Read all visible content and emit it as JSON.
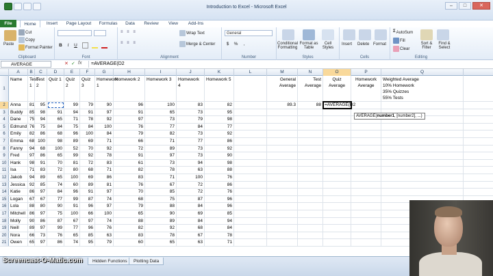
{
  "window": {
    "title": "Introduction to Excel - Microsoft Excel",
    "buttons": {
      "minimize": "–",
      "maximize": "□",
      "close": "✕"
    }
  },
  "tabs": [
    "File",
    "Home",
    "Insert",
    "Page Layout",
    "Formulas",
    "Data",
    "Review",
    "View",
    "Add-Ins"
  ],
  "ribbon": {
    "clipboard": {
      "paste": "Paste",
      "cut": "Cut",
      "copy": "Copy",
      "format_painter": "Format Painter",
      "label": "Clipboard"
    },
    "font": {
      "bold": "B",
      "italic": "I",
      "underline": "U",
      "label": "Font"
    },
    "alignment": {
      "wrap_text": "Wrap Text",
      "merge_center": "Merge & Center",
      "label": "Alignment"
    },
    "number": {
      "format": "General",
      "currency": "$",
      "percent": "%",
      "comma": ",",
      "label": "Number"
    },
    "styles": {
      "conditional": "Conditional Formatting",
      "format_table": "Format as Table",
      "cell_styles": "Cell Styles",
      "label": "Styles"
    },
    "cells": {
      "insert": "Insert",
      "delete": "Delete",
      "format": "Format",
      "label": "Cells"
    },
    "editing": {
      "autosum": "AutoSum",
      "fill": "Fill",
      "clear": "Clear",
      "sort_filter": "Sort & Filter",
      "find_select": "Find & Select",
      "label": "Editing"
    }
  },
  "formula_bar": {
    "name_box": "AVERAGE",
    "cancel": "✕",
    "enter": "✓",
    "fx": "fx",
    "formula": "=AVERAGE(D2"
  },
  "columns": [
    "A",
    "B",
    "C",
    "D",
    "E",
    "F",
    "G",
    "H",
    "I",
    "J",
    "K",
    "L",
    "M",
    "N",
    "O",
    "P",
    "Q"
  ],
  "header_row": {
    "A": "Name",
    "B": "Test 1",
    "C": "Test 2",
    "D": "Quiz 1",
    "E": "Quiz 2",
    "F": "Quiz 3",
    "G": "Homework 1",
    "H": "Homework 2",
    "I": "Homework 3",
    "J": "Homework 4",
    "K": "Homework 5",
    "M": "General Average",
    "N": "Test Average",
    "O": "Quiz Average",
    "P": "Homework Average",
    "Q": [
      "Weighted Average",
      "10% Homework",
      "35% Quizzes",
      "55% Tests"
    ]
  },
  "rows": [
    [
      "Anna",
      81,
      95,
      "",
      99,
      79,
      90,
      96,
      100,
      83,
      82
    ],
    [
      "Buddy",
      85,
      98,
      91,
      94,
      91,
      97,
      91,
      65,
      73,
      95
    ],
    [
      "Dane",
      75,
      94,
      65,
      71,
      78,
      92,
      97,
      73,
      79,
      98
    ],
    [
      "Edmund",
      76,
      75,
      84,
      75,
      84,
      100,
      76,
      77,
      84,
      77
    ],
    [
      "Emily",
      82,
      86,
      68,
      96,
      100,
      84,
      79,
      82,
      73,
      92
    ],
    [
      "Emma",
      68,
      100,
      98,
      89,
      69,
      71,
      66,
      71,
      77,
      86
    ],
    [
      "Fanny",
      94,
      68,
      100,
      52,
      70,
      92,
      72,
      89,
      73,
      92
    ],
    [
      "Fred",
      97,
      86,
      65,
      99,
      92,
      78,
      91,
      97,
      73,
      90
    ],
    [
      "Hank",
      98,
      91,
      70,
      81,
      72,
      83,
      61,
      73,
      94,
      98
    ],
    [
      "Isa",
      71,
      83,
      72,
      80,
      68,
      71,
      82,
      78,
      63,
      88
    ],
    [
      "Jakob",
      94,
      89,
      65,
      100,
      69,
      86,
      83,
      71,
      100,
      76
    ],
    [
      "Jessica",
      92,
      85,
      74,
      60,
      89,
      81,
      76,
      67,
      72,
      86
    ],
    [
      "Katie",
      86,
      97,
      84,
      96,
      91,
      97,
      70,
      85,
      72,
      76
    ],
    [
      "Logan",
      67,
      67,
      77,
      99,
      87,
      74,
      68,
      75,
      87,
      96
    ],
    [
      "Lola",
      88,
      80,
      90,
      91,
      96,
      97,
      79,
      88,
      84,
      96
    ],
    [
      "Mitchell",
      86,
      97,
      75,
      100,
      66,
      100,
      65,
      90,
      69,
      85
    ],
    [
      "Molly",
      90,
      86,
      87,
      67,
      97,
      74,
      88,
      89,
      84,
      94
    ],
    [
      "Neill",
      89,
      97,
      99,
      77,
      96,
      76,
      82,
      92,
      68,
      84
    ],
    [
      "Nora",
      66,
      73,
      76,
      65,
      85,
      63,
      83,
      78,
      67,
      78
    ],
    [
      "Owen",
      65,
      97,
      86,
      74,
      95,
      79,
      60,
      65,
      63,
      71
    ]
  ],
  "row2_extra": {
    "M": "89.3",
    "N": "88",
    "O": "=AVERAGE(D2"
  },
  "tooltip": {
    "fn": "AVERAGE(",
    "arg1": "number1",
    "rest": ", [number2], ...)"
  },
  "sheet_tabs": [
    "Hidden Functions",
    "Plotting Data"
  ],
  "watermark": "Screencast-O-Matic.com"
}
